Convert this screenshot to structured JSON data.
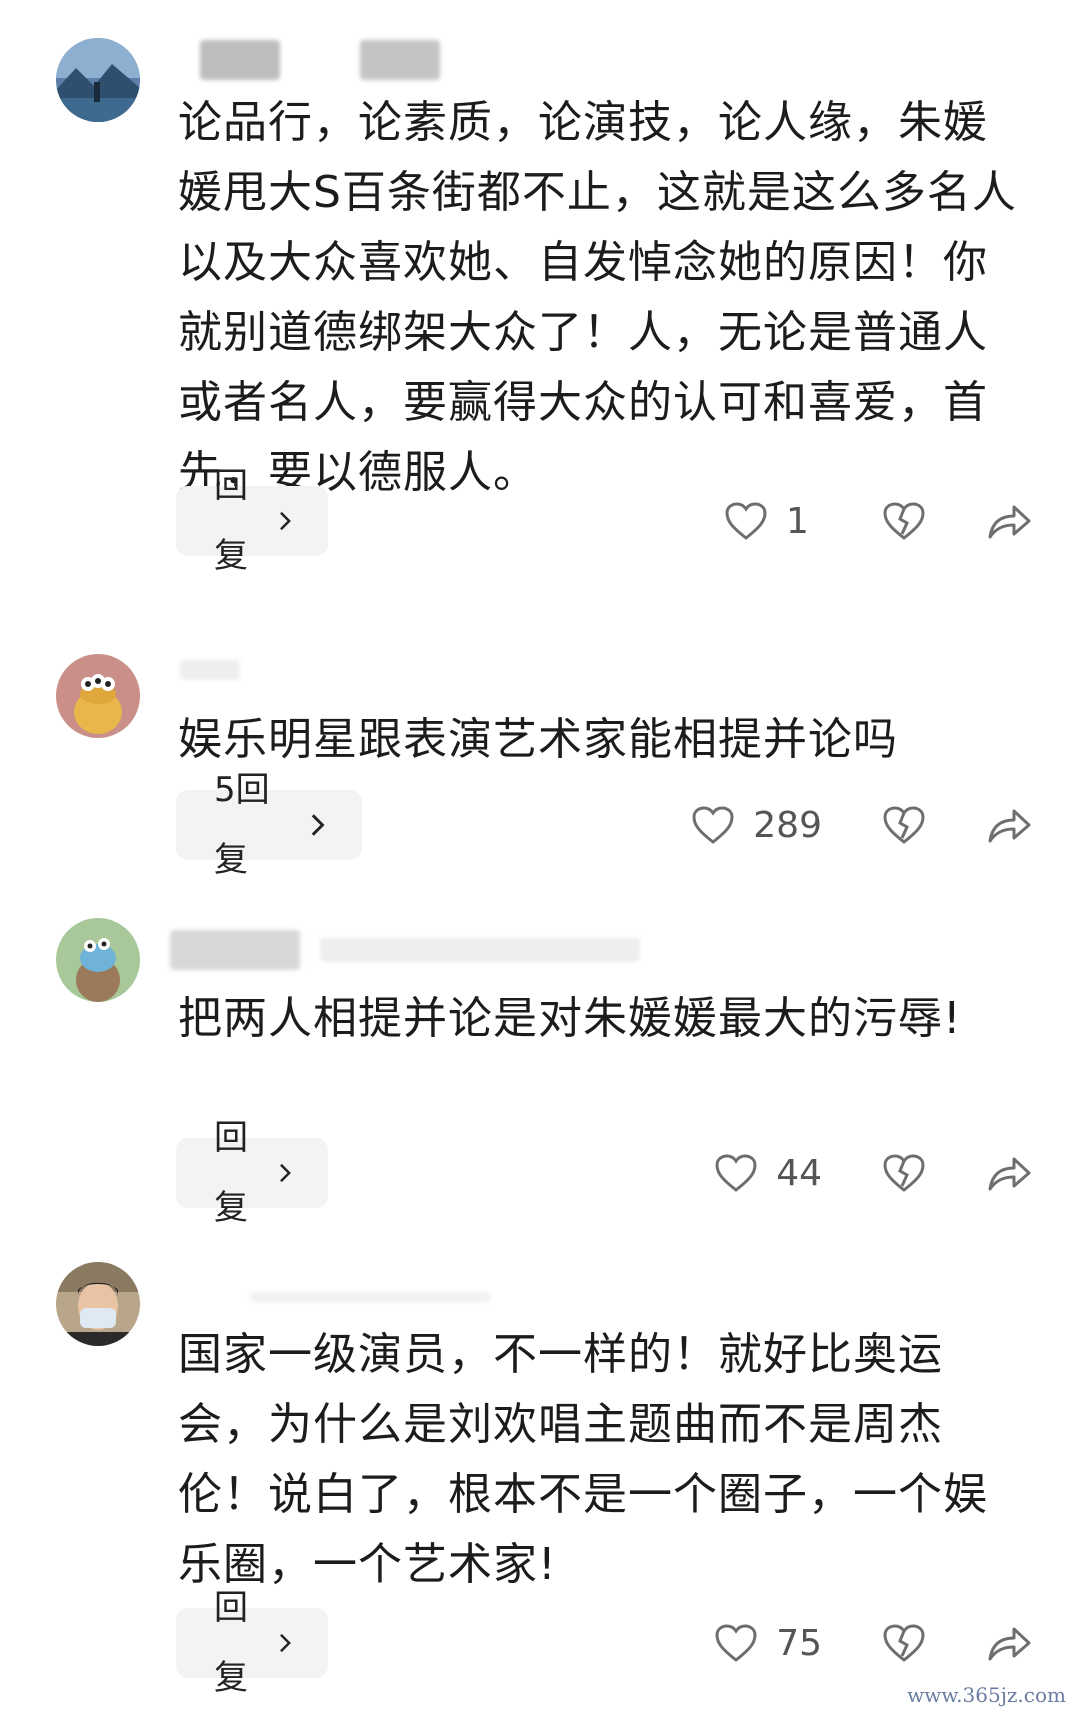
{
  "comments": [
    {
      "text": "论品行，论素质，论演技，论人缘，朱媛媛甩大S百条街都不止，这就是这么多名人以及大众喜欢她、自发悼念她的原因！你就别道德绑架大众了！人，无论是普通人或者名人，要赢得大众的认可和喜爱，首先，要以德服人。",
      "reply_label": "回复",
      "likes": "1"
    },
    {
      "text": "娱乐明星跟表演艺术家能相提并论吗",
      "reply_label": "5回复",
      "likes": "289"
    },
    {
      "text": "把两人相提并论是对朱媛媛最大的污辱!",
      "reply_label": "回复",
      "likes": "44"
    },
    {
      "text": "国家一级演员，不一样的！就好比奥运会，为什么是刘欢唱主题曲而不是周杰伦！说白了，根本不是一个圈子，一个娱乐圈，一个艺术家!",
      "reply_label": "回复",
      "likes": "75"
    }
  ],
  "watermark": "www.365jz.com",
  "icons": {
    "like": "heart-outline-icon",
    "dislike": "broken-heart-icon",
    "share": "share-arrow-icon",
    "reply": "chevron-right-icon"
  },
  "colors": {
    "text": "#1c1c1c",
    "reply_bg": "#f3f3f3",
    "icon": "#6e6e6e"
  }
}
